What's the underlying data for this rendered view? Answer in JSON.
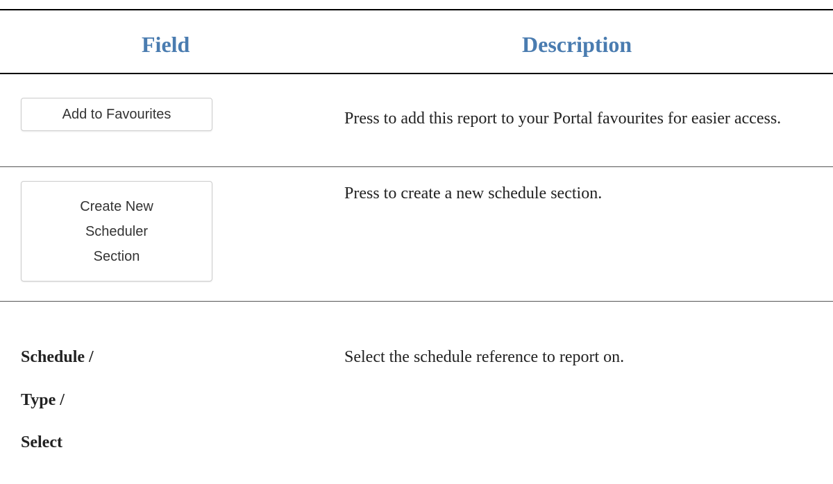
{
  "table": {
    "headers": {
      "field": "Field",
      "description": "Description"
    },
    "rows": [
      {
        "field_button": "Add to Favourites",
        "description": "Press to add this report to your Portal favourites for easier access."
      },
      {
        "field_button": "Create New Scheduler Section",
        "description": "Press to create a new schedule section."
      },
      {
        "field_labels": [
          "Schedule /",
          "Type /",
          "Select"
        ],
        "description": "Select the schedule reference to report on."
      }
    ]
  },
  "colors": {
    "header_text": "#4a7cb0",
    "body_text": "#222222",
    "button_border": "#cccccc"
  }
}
